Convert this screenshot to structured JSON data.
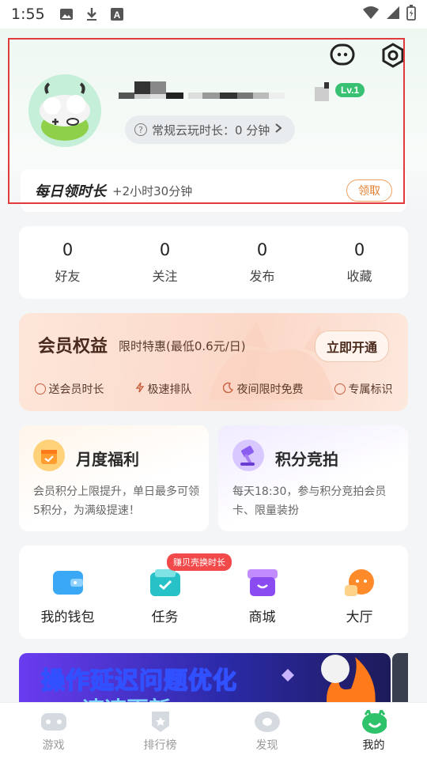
{
  "status_bar": {
    "time": "1:55",
    "icons": [
      "image-icon",
      "download-icon",
      "font-a-icon",
      "wifi-icon",
      "signal-icon",
      "battery-icon"
    ]
  },
  "header": {
    "icons": [
      "chat-bubble-icon",
      "settings-hex-icon"
    ],
    "level": "Lv.1",
    "play_time_label": "常规云玩时长：0 分钟",
    "daily": {
      "title": "每日领时长",
      "subtitle": "+2小时30分钟",
      "claim_label": "领取"
    }
  },
  "stats": [
    {
      "value": "0",
      "label": "好友"
    },
    {
      "value": "0",
      "label": "关注"
    },
    {
      "value": "0",
      "label": "发布"
    },
    {
      "value": "0",
      "label": "收藏"
    }
  ],
  "vip": {
    "title": "会员权益",
    "subtitle": "限时特惠(最低0.6元/日)",
    "button": "立即开通",
    "perks": [
      "送会员时长",
      "极速排队",
      "夜间限时免费",
      "专属标识"
    ]
  },
  "cards": {
    "monthly": {
      "title": "月度福利",
      "desc": "会员积分上限提升，单日最多可领5积分，为满级提速！"
    },
    "auction": {
      "title": "积分竞拍",
      "desc": "每天18:30，参与积分竞拍会员卡、限量装扮"
    }
  },
  "shortcuts": [
    {
      "label": "我的钱包",
      "icon": "wallet-icon"
    },
    {
      "label": "任务",
      "icon": "task-icon",
      "badge": "赚贝壳换时长"
    },
    {
      "label": "商城",
      "icon": "shop-icon"
    },
    {
      "label": "大厅",
      "icon": "hall-icon"
    }
  ],
  "banner": {
    "title": "操作延迟问题优化",
    "subtitle": "速速更新"
  },
  "bottom_nav": [
    {
      "label": "游戏",
      "active": false
    },
    {
      "label": "排行榜",
      "active": false
    },
    {
      "label": "发现",
      "active": false
    },
    {
      "label": "我的",
      "active": true
    }
  ],
  "colors": {
    "accent_green": "#38c172",
    "highlight_red": "#e23b3b",
    "vip_brown": "#4a2a1c",
    "badge_red": "#f24a4a"
  }
}
